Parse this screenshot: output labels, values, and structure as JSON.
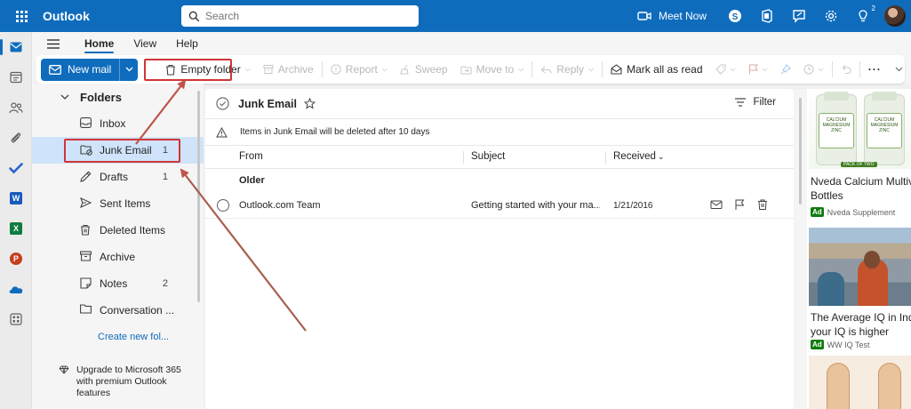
{
  "app": {
    "title": "Outlook"
  },
  "search": {
    "placeholder": "Search"
  },
  "topbar": {
    "meet_now_label": "Meet Now",
    "notification_count": "2"
  },
  "rail": {
    "items": [
      "mail-icon",
      "calendar-icon",
      "people-icon",
      "attach-icon",
      "todo-icon",
      "word-icon",
      "excel-icon",
      "powerpoint-icon",
      "onedrive-icon",
      "apps-icon"
    ]
  },
  "ribbon_tabs": [
    "Home",
    "View",
    "Help"
  ],
  "ribbon": {
    "new_mail": "New mail",
    "empty_folder": "Empty folder",
    "archive": "Archive",
    "report": "Report",
    "sweep": "Sweep",
    "move_to": "Move to",
    "reply": "Reply",
    "mark_all_read": "Mark all as read",
    "more": "···"
  },
  "folders": {
    "header": "Folders",
    "items": [
      {
        "label": "Inbox",
        "count": "",
        "icon": "inbox-icon"
      },
      {
        "label": "Junk Email",
        "count": "1",
        "icon": "junk-icon",
        "selected": true
      },
      {
        "label": "Drafts",
        "count": "1",
        "icon": "drafts-icon"
      },
      {
        "label": "Sent Items",
        "count": "",
        "icon": "send-icon"
      },
      {
        "label": "Deleted Items",
        "count": "",
        "icon": "trash-icon"
      },
      {
        "label": "Archive",
        "count": "",
        "icon": "archive-icon"
      },
      {
        "label": "Notes",
        "count": "2",
        "icon": "notes-icon"
      },
      {
        "label": "Conversation ...",
        "count": "",
        "icon": "folder-icon"
      }
    ],
    "create_new": "Create new fol...",
    "upgrade": "Upgrade to Microsoft 365 with premium Outlook features"
  },
  "mail_list": {
    "title": "Junk Email",
    "filter": "Filter",
    "notice": "Items in Junk Email will be deleted after 10 days",
    "columns": {
      "from": "From",
      "subject": "Subject",
      "received": "Received"
    },
    "group": "Older",
    "rows": [
      {
        "from": "Outlook.com Team",
        "subject": "Getting started with your ma...",
        "received": "1/21/2016"
      }
    ]
  },
  "ads": [
    {
      "title_line1": "Nveda Calcium Multiv",
      "title_line2": "Bottles",
      "badge": "Ad",
      "sponsor": "Nveda Supplement",
      "image_text": [
        "CALCIUM",
        "MAGNESIUM",
        "ZINC"
      ],
      "image_caption": "PACK OF TWO"
    },
    {
      "title_line1": "The Average IQ in Ind",
      "title_line2": "your IQ is higher",
      "badge": "Ad",
      "sponsor": "WW IQ Test"
    }
  ],
  "colors": {
    "brand": "#0f6cbd",
    "highlight": "#d13438",
    "selected": "#cfe4fa",
    "annotation_arrow": "#b65f4f"
  }
}
